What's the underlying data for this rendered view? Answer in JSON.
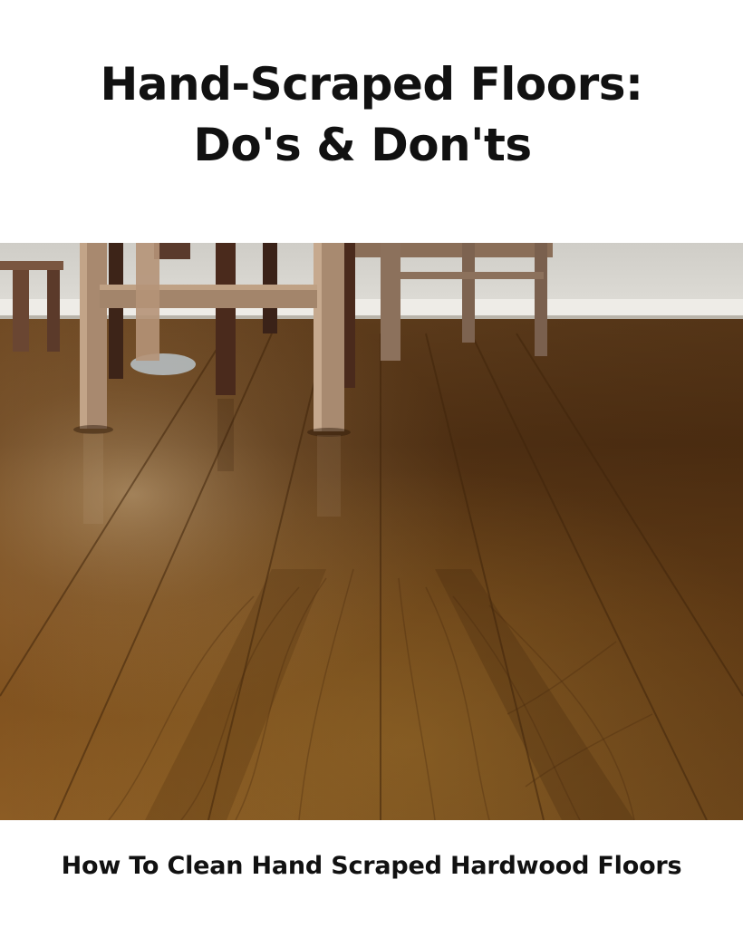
{
  "title": {
    "line1": "Hand-Scraped Floors:",
    "line2": "Do's & Don'ts"
  },
  "photo": {
    "subject": "hardwood-floor-with-chairs",
    "colors": {
      "wall": "#dcdad4",
      "baseboard": "#f1efea",
      "floor_dark": "#5a3413",
      "floor_mid": "#8a5a22",
      "floor_light": "#b07f3a",
      "wood_leg": "#a2826b",
      "dark_leg": "#4a2a1c"
    }
  },
  "caption": "How To Clean Hand Scraped Hardwood Floors"
}
